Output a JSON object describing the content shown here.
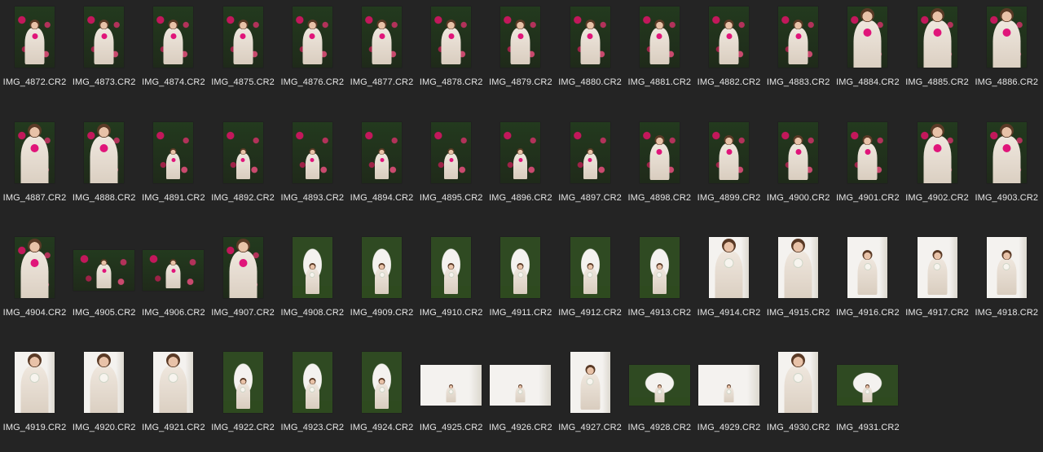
{
  "files": [
    {
      "name": "IMG_4872.CR2",
      "orientation": "portrait",
      "scene": "roses-mid"
    },
    {
      "name": "IMG_4873.CR2",
      "orientation": "portrait",
      "scene": "roses-mid"
    },
    {
      "name": "IMG_4874.CR2",
      "orientation": "portrait",
      "scene": "roses-mid"
    },
    {
      "name": "IMG_4875.CR2",
      "orientation": "portrait",
      "scene": "roses-mid"
    },
    {
      "name": "IMG_4876.CR2",
      "orientation": "portrait",
      "scene": "roses-mid"
    },
    {
      "name": "IMG_4877.CR2",
      "orientation": "portrait",
      "scene": "roses-mid"
    },
    {
      "name": "IMG_4878.CR2",
      "orientation": "portrait",
      "scene": "roses-mid"
    },
    {
      "name": "IMG_4879.CR2",
      "orientation": "portrait",
      "scene": "roses-mid"
    },
    {
      "name": "IMG_4880.CR2",
      "orientation": "portrait",
      "scene": "roses-mid"
    },
    {
      "name": "IMG_4881.CR2",
      "orientation": "portrait",
      "scene": "roses-mid"
    },
    {
      "name": "IMG_4882.CR2",
      "orientation": "portrait",
      "scene": "roses-mid"
    },
    {
      "name": "IMG_4883.CR2",
      "orientation": "portrait",
      "scene": "roses-mid"
    },
    {
      "name": "IMG_4884.CR2",
      "orientation": "portrait",
      "scene": "roses-close"
    },
    {
      "name": "IMG_4885.CR2",
      "orientation": "portrait",
      "scene": "roses-close"
    },
    {
      "name": "IMG_4886.CR2",
      "orientation": "portrait",
      "scene": "roses-close"
    },
    {
      "name": "IMG_4887.CR2",
      "orientation": "portrait",
      "scene": "roses-close"
    },
    {
      "name": "IMG_4888.CR2",
      "orientation": "portrait",
      "scene": "roses-close"
    },
    {
      "name": "IMG_4891.CR2",
      "orientation": "portrait",
      "scene": "roses-full"
    },
    {
      "name": "IMG_4892.CR2",
      "orientation": "portrait",
      "scene": "roses-full"
    },
    {
      "name": "IMG_4893.CR2",
      "orientation": "portrait",
      "scene": "roses-full"
    },
    {
      "name": "IMG_4894.CR2",
      "orientation": "portrait",
      "scene": "roses-full"
    },
    {
      "name": "IMG_4895.CR2",
      "orientation": "portrait",
      "scene": "roses-full"
    },
    {
      "name": "IMG_4896.CR2",
      "orientation": "portrait",
      "scene": "roses-full"
    },
    {
      "name": "IMG_4897.CR2",
      "orientation": "portrait",
      "scene": "roses-full"
    },
    {
      "name": "IMG_4898.CR2",
      "orientation": "portrait",
      "scene": "roses-mid"
    },
    {
      "name": "IMG_4899.CR2",
      "orientation": "portrait",
      "scene": "roses-mid"
    },
    {
      "name": "IMG_4900.CR2",
      "orientation": "portrait",
      "scene": "roses-mid"
    },
    {
      "name": "IMG_4901.CR2",
      "orientation": "portrait",
      "scene": "roses-mid"
    },
    {
      "name": "IMG_4902.CR2",
      "orientation": "portrait",
      "scene": "roses-close"
    },
    {
      "name": "IMG_4903.CR2",
      "orientation": "portrait",
      "scene": "roses-close"
    },
    {
      "name": "IMG_4904.CR2",
      "orientation": "portrait",
      "scene": "roses-close"
    },
    {
      "name": "IMG_4905.CR2",
      "orientation": "landscape",
      "scene": "roses-mid"
    },
    {
      "name": "IMG_4906.CR2",
      "orientation": "landscape",
      "scene": "roses-mid"
    },
    {
      "name": "IMG_4907.CR2",
      "orientation": "portrait",
      "scene": "roses-close"
    },
    {
      "name": "IMG_4908.CR2",
      "orientation": "portrait",
      "scene": "arch-full"
    },
    {
      "name": "IMG_4909.CR2",
      "orientation": "portrait",
      "scene": "arch-full"
    },
    {
      "name": "IMG_4910.CR2",
      "orientation": "portrait",
      "scene": "arch-full"
    },
    {
      "name": "IMG_4911.CR2",
      "orientation": "portrait",
      "scene": "arch-full"
    },
    {
      "name": "IMG_4912.CR2",
      "orientation": "portrait",
      "scene": "arch-full"
    },
    {
      "name": "IMG_4913.CR2",
      "orientation": "portrait",
      "scene": "arch-full"
    },
    {
      "name": "IMG_4914.CR2",
      "orientation": "portrait",
      "scene": "white-close"
    },
    {
      "name": "IMG_4915.CR2",
      "orientation": "portrait",
      "scene": "white-close"
    },
    {
      "name": "IMG_4916.CR2",
      "orientation": "portrait",
      "scene": "white-mid"
    },
    {
      "name": "IMG_4917.CR2",
      "orientation": "portrait",
      "scene": "white-mid"
    },
    {
      "name": "IMG_4918.CR2",
      "orientation": "portrait",
      "scene": "white-mid"
    },
    {
      "name": "IMG_4919.CR2",
      "orientation": "portrait",
      "scene": "white-close"
    },
    {
      "name": "IMG_4920.CR2",
      "orientation": "portrait",
      "scene": "white-close"
    },
    {
      "name": "IMG_4921.CR2",
      "orientation": "portrait",
      "scene": "white-close"
    },
    {
      "name": "IMG_4922.CR2",
      "orientation": "portrait",
      "scene": "arch-full"
    },
    {
      "name": "IMG_4923.CR2",
      "orientation": "portrait",
      "scene": "arch-full"
    },
    {
      "name": "IMG_4924.CR2",
      "orientation": "portrait",
      "scene": "arch-full"
    },
    {
      "name": "IMG_4925.CR2",
      "orientation": "landscape",
      "scene": "white-wide"
    },
    {
      "name": "IMG_4926.CR2",
      "orientation": "landscape",
      "scene": "white-wide"
    },
    {
      "name": "IMG_4927.CR2",
      "orientation": "portrait",
      "scene": "white-mid"
    },
    {
      "name": "IMG_4928.CR2",
      "orientation": "landscape",
      "scene": "arch-wide"
    },
    {
      "name": "IMG_4929.CR2",
      "orientation": "landscape",
      "scene": "white-wide"
    },
    {
      "name": "IMG_4930.CR2",
      "orientation": "portrait",
      "scene": "white-close"
    },
    {
      "name": "IMG_4931.CR2",
      "orientation": "landscape",
      "scene": "arch-wide"
    }
  ],
  "colors": {
    "background": "#242424",
    "caption": "#e6e6e6",
    "roses_bg": "#1f2a1a",
    "rose_pink": "#c2185b",
    "white_bg": "#f4f2ef",
    "dress": "#e9e0d6",
    "foliage": "#2f4a22",
    "grass": "#2e4a1f"
  }
}
